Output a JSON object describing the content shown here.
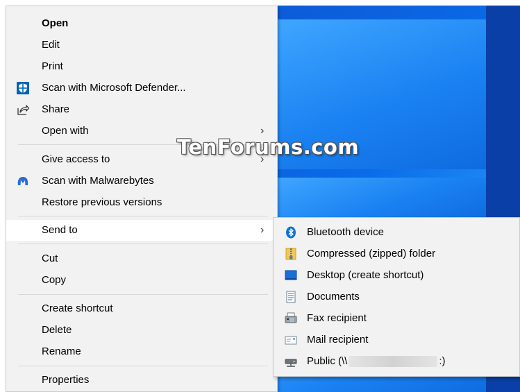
{
  "watermark": "TenForums.com",
  "menu": {
    "open": "Open",
    "edit": "Edit",
    "print": "Print",
    "scan_defender": "Scan with Microsoft Defender...",
    "share": "Share",
    "open_with": "Open with",
    "give_access": "Give access to",
    "scan_malwarebytes": "Scan with Malwarebytes",
    "restore_versions": "Restore previous versions",
    "send_to": "Send to",
    "cut": "Cut",
    "copy": "Copy",
    "create_shortcut": "Create shortcut",
    "delete": "Delete",
    "rename": "Rename",
    "properties": "Properties",
    "arrow": "›"
  },
  "send_to": {
    "bluetooth": "Bluetooth device",
    "compressed": "Compressed (zipped) folder",
    "desktop": "Desktop (create shortcut)",
    "documents": "Documents",
    "fax": "Fax recipient",
    "mail": "Mail recipient",
    "public_prefix": "Public (\\\\",
    "public_suffix": ":)"
  },
  "colors": {
    "menu_bg": "#f2f2f2",
    "hover_bg": "#ffffff",
    "wallpaper": "#0a6ae8",
    "defender_blue": "#0063b1",
    "malwarebytes_blue": "#2b6cd8"
  },
  "icons": {
    "defender": "shield-icon",
    "share": "share-icon",
    "malwarebytes": "malwarebytes-icon",
    "bluetooth": "bluetooth-icon",
    "zip": "zip-folder-icon",
    "desktop": "desktop-icon",
    "documents": "documents-icon",
    "fax": "fax-icon",
    "mail": "mail-icon",
    "network": "network-drive-icon"
  }
}
